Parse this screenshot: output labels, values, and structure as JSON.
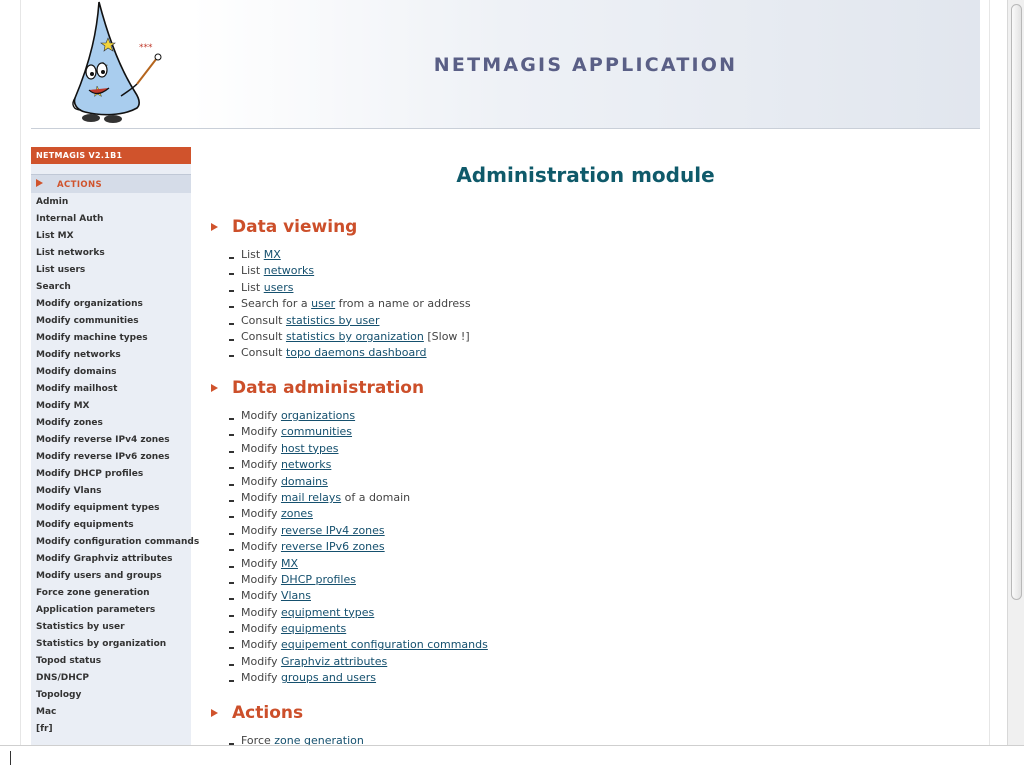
{
  "header": {
    "title": "NETMAGIS APPLICATION"
  },
  "sidebar": {
    "version": "NETMAGIS V2.1B1",
    "actions_label": "ACTIONS",
    "items": [
      "Admin",
      "Internal Auth",
      "List MX",
      "List networks",
      "List users",
      "Search",
      "Modify organizations",
      "Modify communities",
      "Modify machine types",
      "Modify networks",
      "Modify domains",
      "Modify mailhost",
      "Modify MX",
      "Modify zones",
      "Modify reverse IPv4 zones",
      "Modify reverse IPv6 zones",
      "Modify DHCP profiles",
      "Modify Vlans",
      "Modify equipment types",
      "Modify equipments",
      "Modify configuration commands",
      "Modify Graphviz attributes",
      "Modify users and groups",
      "Force zone generation",
      "Application parameters",
      "Statistics by user",
      "Statistics by organization",
      "Topod status",
      "DNS/DHCP",
      "Topology",
      "Mac",
      "[fr]"
    ]
  },
  "main": {
    "title": "Administration module",
    "sections": [
      {
        "title": "Data viewing",
        "items": [
          {
            "pre": "List ",
            "link": "MX",
            "post": ""
          },
          {
            "pre": "List ",
            "link": "networks",
            "post": ""
          },
          {
            "pre": "List ",
            "link": "users",
            "post": ""
          },
          {
            "pre": "Search for a ",
            "link": "user",
            "post": " from a name or address"
          },
          {
            "pre": "Consult ",
            "link": "statistics by user",
            "post": ""
          },
          {
            "pre": "Consult ",
            "link": "statistics by organization",
            "post": " [Slow !]"
          },
          {
            "pre": "Consult ",
            "link": "topo daemons dashboard",
            "post": ""
          }
        ]
      },
      {
        "title": "Data administration",
        "items": [
          {
            "pre": "Modify ",
            "link": "organizations",
            "post": ""
          },
          {
            "pre": "Modify ",
            "link": "communities",
            "post": ""
          },
          {
            "pre": "Modify ",
            "link": "host types",
            "post": ""
          },
          {
            "pre": "Modify ",
            "link": "networks",
            "post": ""
          },
          {
            "pre": "Modify ",
            "link": "domains",
            "post": ""
          },
          {
            "pre": "Modify ",
            "link": "mail relays",
            "post": " of a domain"
          },
          {
            "pre": "Modify ",
            "link": "zones",
            "post": ""
          },
          {
            "pre": "Modify ",
            "link": "reverse IPv4 zones",
            "post": ""
          },
          {
            "pre": "Modify ",
            "link": "reverse IPv6 zones",
            "post": ""
          },
          {
            "pre": "Modify ",
            "link": "MX",
            "post": ""
          },
          {
            "pre": "Modify ",
            "link": "DHCP profiles",
            "post": ""
          },
          {
            "pre": "Modify ",
            "link": "Vlans",
            "post": ""
          },
          {
            "pre": "Modify ",
            "link": "equipment types",
            "post": ""
          },
          {
            "pre": "Modify ",
            "link": "equipments",
            "post": ""
          },
          {
            "pre": "Modify ",
            "link": "equipement configuration commands",
            "post": ""
          },
          {
            "pre": "Modify ",
            "link": "Graphviz attributes",
            "post": ""
          },
          {
            "pre": "Modify ",
            "link": "groups and users",
            "post": ""
          }
        ]
      },
      {
        "title": "Actions",
        "items": [
          {
            "pre": "Force ",
            "link": "zone generation",
            "post": ""
          }
        ]
      }
    ]
  },
  "colors": {
    "accent": "#cc4f2a",
    "title": "#0f5a6a",
    "link": "#15506e",
    "header_text": "#5a5f86",
    "sidebar_bg": "#eaeef5"
  }
}
